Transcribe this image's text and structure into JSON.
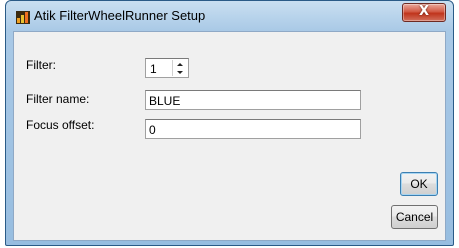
{
  "window": {
    "title": "Atik FilterWheelRunner Setup",
    "close_glyph": "X"
  },
  "form": {
    "filter_label": "Filter:",
    "filter_value": "1",
    "filter_name_label": "Filter name:",
    "filter_name_value": "BLUE",
    "focus_offset_label": "Focus offset:",
    "focus_offset_value": "0"
  },
  "buttons": {
    "ok_label": "OK",
    "cancel_label": "Cancel"
  },
  "icons": {
    "app": "chart-bars-icon",
    "close": "close-icon",
    "spin_up": "chevron-up-icon",
    "spin_down": "chevron-down-icon"
  },
  "colors": {
    "titlebar": "#a9c9e6",
    "close_button": "#c9452e",
    "dialog_body": "#f0f0f0"
  }
}
